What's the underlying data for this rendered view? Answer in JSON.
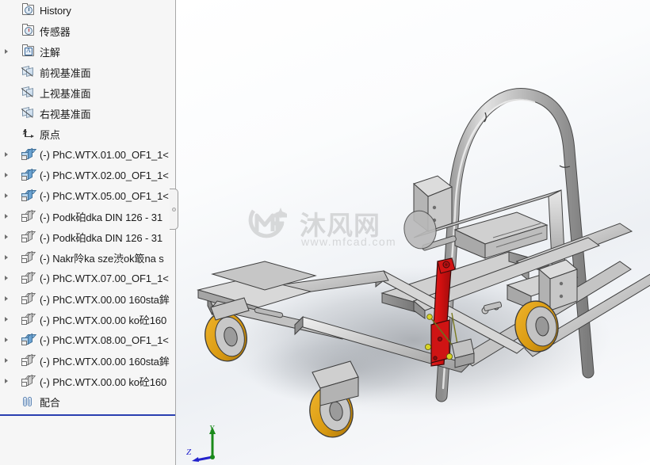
{
  "tree": {
    "items": [
      {
        "label": "History",
        "icon": "history-folder-icon",
        "expandable": false,
        "indent": 0
      },
      {
        "label": "传感器",
        "icon": "sensors-folder-icon",
        "expandable": false,
        "indent": 0
      },
      {
        "label": "注解",
        "icon": "annotations-folder-icon",
        "expandable": true,
        "indent": 0
      },
      {
        "label": "前视基准面",
        "icon": "plane-icon",
        "expandable": false,
        "indent": 0
      },
      {
        "label": "上视基准面",
        "icon": "plane-icon",
        "expandable": false,
        "indent": 0
      },
      {
        "label": "右视基准面",
        "icon": "plane-icon",
        "expandable": false,
        "indent": 0
      },
      {
        "label": "原点",
        "icon": "origin-icon",
        "expandable": false,
        "indent": 0
      },
      {
        "label": "(-) PhC.WTX.01.00_OF1_1<",
        "icon": "assembly-icon",
        "expandable": true,
        "indent": 0
      },
      {
        "label": "(-) PhC.WTX.02.00_OF1_1<",
        "icon": "assembly-icon",
        "expandable": true,
        "indent": 0
      },
      {
        "label": "(-) PhC.WTX.05.00_OF1_1<",
        "icon": "assembly-icon",
        "expandable": true,
        "indent": 0
      },
      {
        "label": "(-) Podk砶dka DIN 126 - 31",
        "icon": "part-icon",
        "expandable": true,
        "indent": 0
      },
      {
        "label": "(-) Podk砶dka DIN 126 - 31",
        "icon": "part-icon",
        "expandable": true,
        "indent": 0
      },
      {
        "label": "(-) Nakr阾ka sze渋ok箃na s",
        "icon": "part-icon",
        "expandable": true,
        "indent": 0
      },
      {
        "label": "(-) PhC.WTX.07.00_OF1_1<",
        "icon": "part-icon",
        "expandable": true,
        "indent": 0
      },
      {
        "label": "(-) PhC.WTX.00.00 160sta鉾",
        "icon": "part-icon",
        "expandable": true,
        "indent": 0
      },
      {
        "label": "(-) PhC.WTX.00.00 ko砼160",
        "icon": "part-icon",
        "expandable": true,
        "indent": 0
      },
      {
        "label": "(-) PhC.WTX.08.00_OF1_1<",
        "icon": "assembly-icon",
        "expandable": true,
        "indent": 0
      },
      {
        "label": "(-) PhC.WTX.00.00 160sta鉾",
        "icon": "part-icon",
        "expandable": true,
        "indent": 0
      },
      {
        "label": "(-) PhC.WTX.00.00 ko砼160",
        "icon": "part-icon",
        "expandable": true,
        "indent": 0
      },
      {
        "label": "配合",
        "icon": "mates-icon",
        "expandable": false,
        "indent": 0
      }
    ]
  },
  "viewport": {
    "watermark": {
      "brand": "沐风网",
      "url": "www.mfcad.com"
    },
    "triad": {
      "y": "Y",
      "z": "Z"
    },
    "model_name": "cart-assembly"
  },
  "colors": {
    "panel_background": "#f6f6f6",
    "panel_border": "#a8a8a8",
    "insertion_bar": "#2a3fb0",
    "tree_text": "#1b1b1b",
    "viewport_background": "#ffffff",
    "lever_red": "#d21010",
    "wheel_orange": "#d99a12",
    "steel_gray": "#c9c9c9",
    "axis_y_green": "#1a8a1a",
    "axis_z_blue": "#2222cc",
    "watermark_gray": "#8f8f8f"
  }
}
